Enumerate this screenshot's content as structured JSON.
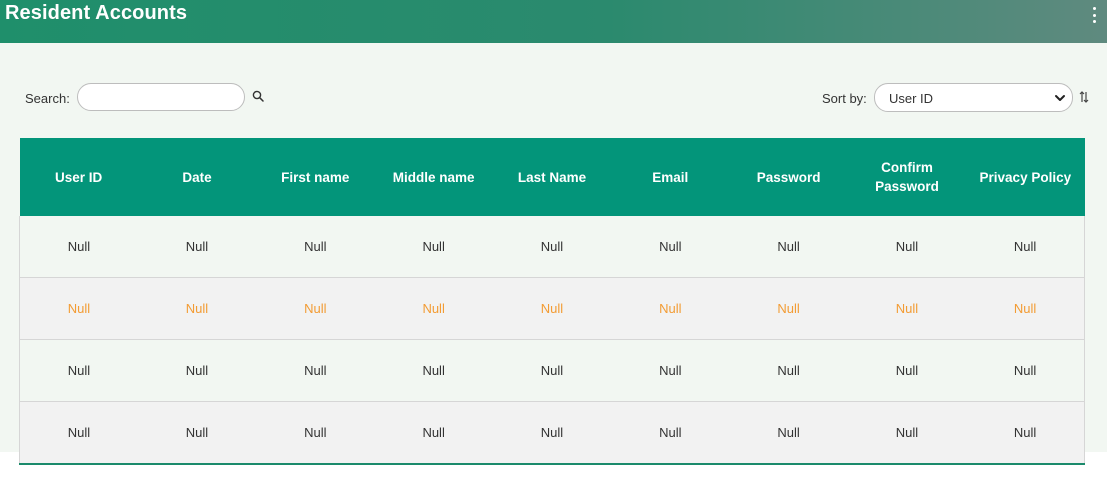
{
  "header": {
    "title": "Resident Accounts",
    "menu_icon": "kebab-menu-icon"
  },
  "search": {
    "label": "Search:",
    "value": "",
    "placeholder": "",
    "icon": "search-icon"
  },
  "sort": {
    "label": "Sort by:",
    "selected": "User ID",
    "order_icon": "sort-order-icon"
  },
  "table": {
    "columns": [
      "User ID",
      "Date",
      "First name",
      "Middle name",
      "Last Name",
      "Email",
      "Password",
      "Confirm Password",
      "Privacy Policy"
    ],
    "rows": [
      [
        "Null",
        "Null",
        "Null",
        "Null",
        "Null",
        "Null",
        "Null",
        "Null",
        "Null"
      ],
      [
        "Null",
        "Null",
        "Null",
        "Null",
        "Null",
        "Null",
        "Null",
        "Null",
        "Null"
      ],
      [
        "Null",
        "Null",
        "Null",
        "Null",
        "Null",
        "Null",
        "Null",
        "Null",
        "Null"
      ],
      [
        "Null",
        "Null",
        "Null",
        "Null",
        "Null",
        "Null",
        "Null",
        "Null",
        "Null"
      ]
    ]
  },
  "colors": {
    "header_bg": "#1f8f6b",
    "table_header_bg": "#03957a",
    "highlight_text": "#f39c34"
  }
}
